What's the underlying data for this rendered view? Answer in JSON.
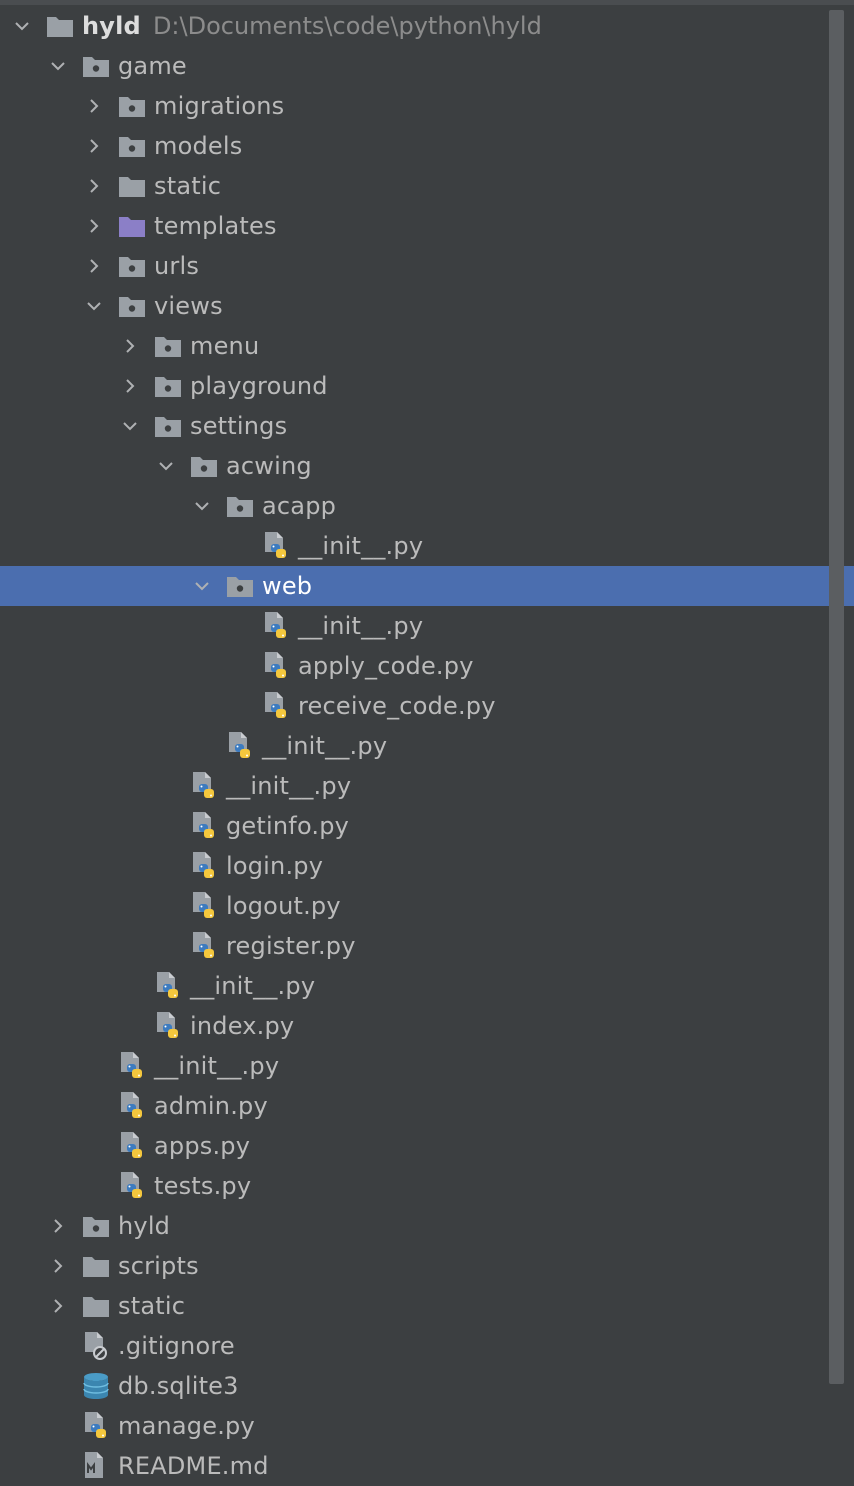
{
  "project": {
    "name": "hyld",
    "path": "D:\\Documents\\code\\python\\hyld"
  },
  "colors": {
    "background": "#3c3f41",
    "selection": "#4b6eaf",
    "text": "#bbbbbb",
    "folder": "#9aa0a6",
    "templates_folder": "#8b7fc7",
    "python_blue": "#3c7bbf",
    "python_yellow": "#f4c73d"
  },
  "tree": [
    {
      "label": "game",
      "depth": 1,
      "icon": "package-folder-icon",
      "arrow": "down"
    },
    {
      "label": "migrations",
      "depth": 2,
      "icon": "package-folder-icon",
      "arrow": "right"
    },
    {
      "label": "models",
      "depth": 2,
      "icon": "package-folder-icon",
      "arrow": "right"
    },
    {
      "label": "static",
      "depth": 2,
      "icon": "folder-icon",
      "arrow": "right"
    },
    {
      "label": "templates",
      "depth": 2,
      "icon": "templates-folder-icon",
      "arrow": "right"
    },
    {
      "label": "urls",
      "depth": 2,
      "icon": "package-folder-icon",
      "arrow": "right"
    },
    {
      "label": "views",
      "depth": 2,
      "icon": "package-folder-icon",
      "arrow": "down"
    },
    {
      "label": "menu",
      "depth": 3,
      "icon": "package-folder-icon",
      "arrow": "right"
    },
    {
      "label": "playground",
      "depth": 3,
      "icon": "package-folder-icon",
      "arrow": "right"
    },
    {
      "label": "settings",
      "depth": 3,
      "icon": "package-folder-icon",
      "arrow": "down"
    },
    {
      "label": "acwing",
      "depth": 4,
      "icon": "package-folder-icon",
      "arrow": "down"
    },
    {
      "label": "acapp",
      "depth": 5,
      "icon": "package-folder-icon",
      "arrow": "down"
    },
    {
      "label": "__init__.py",
      "depth": 6,
      "icon": "python-file-icon",
      "arrow": "none"
    },
    {
      "label": "web",
      "depth": 5,
      "icon": "package-folder-icon",
      "arrow": "down",
      "selected": true
    },
    {
      "label": "__init__.py",
      "depth": 6,
      "icon": "python-file-icon",
      "arrow": "none"
    },
    {
      "label": "apply_code.py",
      "depth": 6,
      "icon": "python-file-icon",
      "arrow": "none"
    },
    {
      "label": "receive_code.py",
      "depth": 6,
      "icon": "python-file-icon",
      "arrow": "none"
    },
    {
      "label": "__init__.py",
      "depth": 5,
      "icon": "python-file-icon",
      "arrow": "none"
    },
    {
      "label": "__init__.py",
      "depth": 4,
      "icon": "python-file-icon",
      "arrow": "none"
    },
    {
      "label": "getinfo.py",
      "depth": 4,
      "icon": "python-file-icon",
      "arrow": "none"
    },
    {
      "label": "login.py",
      "depth": 4,
      "icon": "python-file-icon",
      "arrow": "none"
    },
    {
      "label": "logout.py",
      "depth": 4,
      "icon": "python-file-icon",
      "arrow": "none"
    },
    {
      "label": "register.py",
      "depth": 4,
      "icon": "python-file-icon",
      "arrow": "none"
    },
    {
      "label": "__init__.py",
      "depth": 3,
      "icon": "python-file-icon",
      "arrow": "none"
    },
    {
      "label": "index.py",
      "depth": 3,
      "icon": "python-file-icon",
      "arrow": "none"
    },
    {
      "label": "__init__.py",
      "depth": 2,
      "icon": "python-file-icon",
      "arrow": "none"
    },
    {
      "label": "admin.py",
      "depth": 2,
      "icon": "python-file-icon",
      "arrow": "none"
    },
    {
      "label": "apps.py",
      "depth": 2,
      "icon": "python-file-icon",
      "arrow": "none"
    },
    {
      "label": "tests.py",
      "depth": 2,
      "icon": "python-file-icon",
      "arrow": "none"
    },
    {
      "label": "hyld",
      "depth": 1,
      "icon": "package-folder-icon",
      "arrow": "right"
    },
    {
      "label": "scripts",
      "depth": 1,
      "icon": "folder-icon",
      "arrow": "right"
    },
    {
      "label": "static",
      "depth": 1,
      "icon": "folder-icon",
      "arrow": "right"
    },
    {
      "label": ".gitignore",
      "depth": 1,
      "icon": "gitignore-file-icon",
      "arrow": "none"
    },
    {
      "label": "db.sqlite3",
      "depth": 1,
      "icon": "database-icon",
      "arrow": "none"
    },
    {
      "label": "manage.py",
      "depth": 1,
      "icon": "python-file-icon",
      "arrow": "none"
    },
    {
      "label": "README.md",
      "depth": 1,
      "icon": "markdown-file-icon",
      "arrow": "none"
    }
  ]
}
